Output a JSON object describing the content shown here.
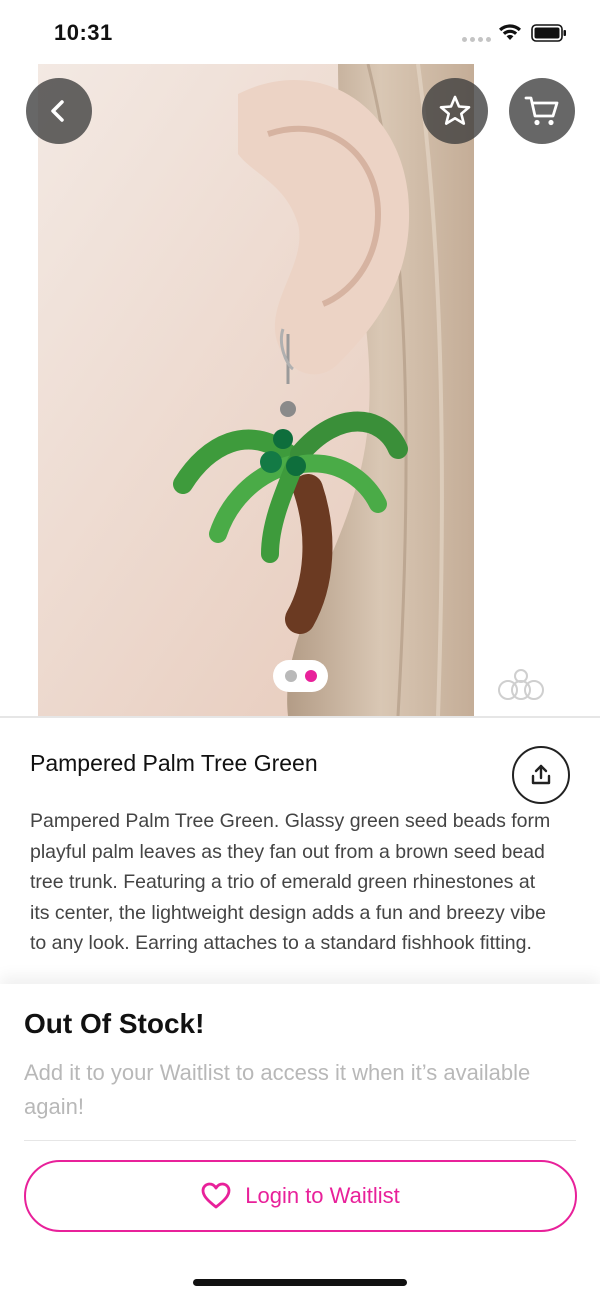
{
  "status_bar": {
    "time": "10:31"
  },
  "product": {
    "image_description_icon": "beaded-palm-tree-earring-photo",
    "title": "Pampered Palm Tree Green",
    "description": "Pampered Palm Tree Green. Glassy green seed beads form playful palm leaves as they fan out from a brown seed bead tree trunk. Featuring a trio of emerald green rhinestones at its center, the lightweight design adds a fun and breezy vibe to any look. Earring attaches to a standard fishhook fitting.",
    "carousel": {
      "count": 2,
      "active_index": 1
    }
  },
  "header_buttons": {
    "back_icon": "chevron-left-icon",
    "favorite_icon": "star-icon",
    "cart_icon": "cart-icon"
  },
  "stock": {
    "title": "Out Of Stock!",
    "subtitle": "Add it to your Waitlist to access it when it’s available again!",
    "button_label": "Login to Waitlist",
    "button_icon": "heart-icon"
  },
  "colors": {
    "accent": "#e8219a",
    "button_overlay": "#3c3c3c",
    "muted_text": "#b8b8b8"
  }
}
